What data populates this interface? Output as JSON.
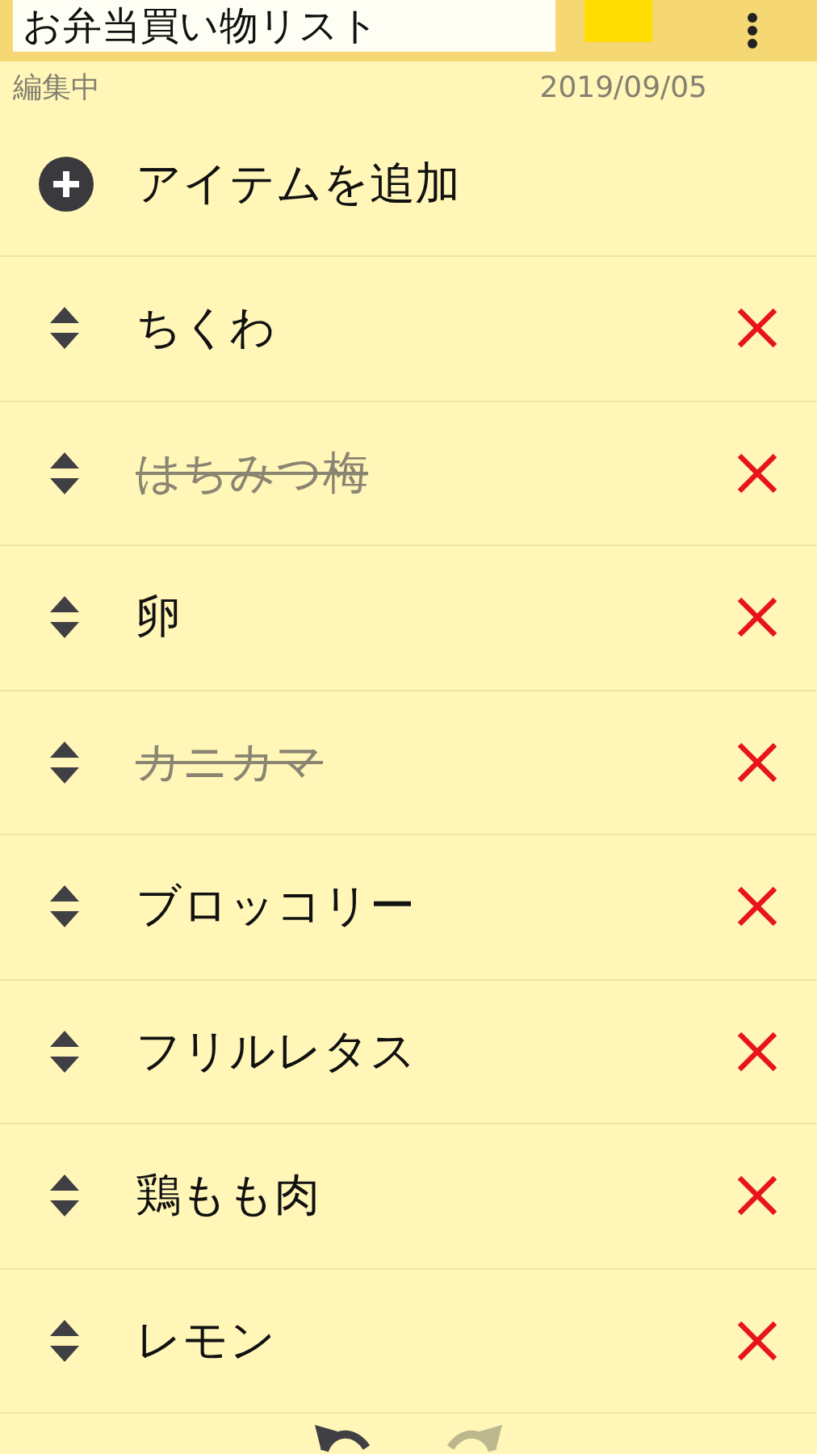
{
  "title": "お弁当買い物リスト",
  "color_swatch": {
    "color": "#ffdd00"
  },
  "status": "編集中",
  "date": "2019/09/05",
  "add_item": "アイテムを追加",
  "items": [
    {
      "text": "ちくわ",
      "checked": false
    },
    {
      "text": "はちみつ梅",
      "checked": true
    },
    {
      "text": "卵",
      "checked": false
    },
    {
      "text": "カニカマ",
      "checked": true
    },
    {
      "text": "ブロッコリー",
      "checked": false
    },
    {
      "text": "フリルレタス",
      "checked": false
    },
    {
      "text": "鶏もも肉",
      "checked": false
    },
    {
      "text": "レモン",
      "checked": false
    }
  ],
  "toolbar": {
    "undo_disabled": false,
    "redo_disabled": true
  }
}
